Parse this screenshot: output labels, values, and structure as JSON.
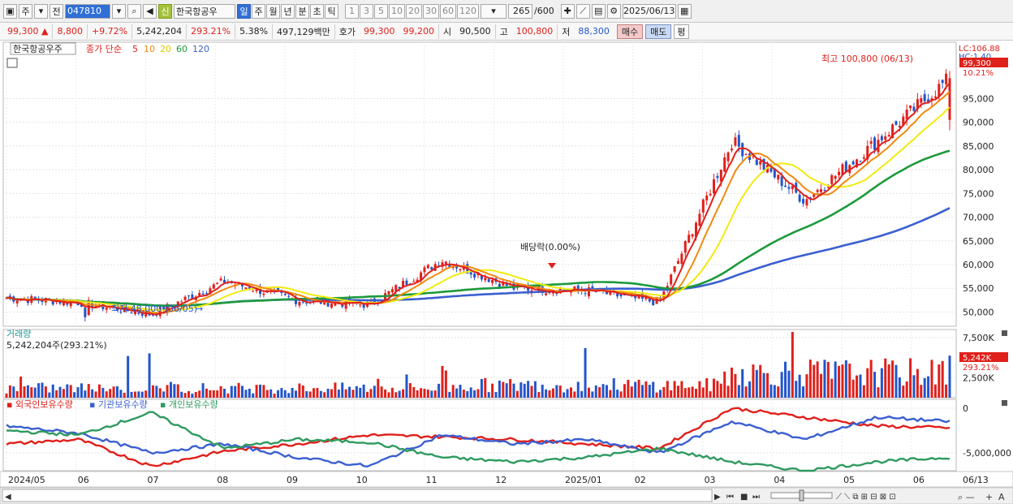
{
  "toolbar": {
    "market_select": "주",
    "scope_select": "전",
    "stock_code": "047810",
    "new_badge": "신",
    "stock_name": "한국항공우",
    "periods": [
      "일",
      "주",
      "월",
      "년",
      "분",
      "초",
      "틱"
    ],
    "selected_period": "일",
    "intervals": [
      "1",
      "3",
      "5",
      "10",
      "20",
      "30",
      "60",
      "120"
    ],
    "count": "265",
    "count_max": "/600",
    "date": "2025/06/13"
  },
  "quote": {
    "price": "99,300",
    "arrow": "▲",
    "change": "8,800",
    "change_pct": "+9.72%",
    "volume": "5,242,204",
    "volume_ratio": "293.21%",
    "turnover": "5.38%",
    "amount": "497,129백만",
    "hoga_label": "호가",
    "ask": "99,300",
    "bid": "99,200",
    "open_label": "시",
    "open": "90,500",
    "high_label": "고",
    "high": "100,800",
    "low_label": "저",
    "low": "88,300",
    "buy_label": "매수",
    "sell_label": "매도",
    "avg_label": "평"
  },
  "legend": {
    "name": "한국항공우주",
    "ma_label": "종가 단순",
    "periods": [
      "5",
      "10",
      "20",
      "60",
      "120"
    ]
  },
  "price_axis": {
    "lc_label": "LC:106.88",
    "hc_label": "HC:1.40",
    "last_price": "99,300",
    "last_pct": "10.21%",
    "ticks": [
      "95,000",
      "90,000",
      "85,000",
      "80,000",
      "75,000",
      "70,000",
      "65,000",
      "60,000",
      "55,000",
      "50,000"
    ]
  },
  "annotations": {
    "high": "최고 100,800 (06/13)",
    "low": "최저 48,000 (06/05)",
    "dividend": "배당락(0.00%)"
  },
  "volume_pane": {
    "title": "거래량",
    "value": "5,242,204주(293.21%)",
    "ticks": [
      "7,500K",
      "2,500K"
    ],
    "last_value": "5,242K",
    "last_pct": "293.21%"
  },
  "holdings_pane": {
    "series_labels": [
      "외국인보유수량",
      "기관보유수량",
      "개인보유수량"
    ],
    "ticks": [
      "0",
      "-5,000,000"
    ]
  },
  "x_axis": {
    "labels": [
      "2024/05",
      "06",
      "07",
      "08",
      "09",
      "10",
      "11",
      "12",
      "2025/01",
      "02",
      "03",
      "04",
      "05",
      "06"
    ],
    "right_label": "06/13"
  },
  "colors": {
    "up": "#e0201b",
    "down": "#2255cc",
    "ma5": "#e0201b",
    "ma10": "#f08a10",
    "ma20": "#f2ea10",
    "ma60": "#1d9a3c",
    "ma120": "#3a5fd0",
    "foreign": "#e0201b",
    "institution": "#3a5fd0",
    "individual": "#2e9a60"
  },
  "chart_data": {
    "type": "candlestick",
    "title": "한국항공우주",
    "x": [
      "2024/05",
      "06",
      "07",
      "08",
      "09",
      "10",
      "11",
      "12",
      "2025/01",
      "02",
      "03",
      "04",
      "05",
      "06/13"
    ],
    "price_close_anchors": [
      53000,
      52000,
      49500,
      56500,
      52500,
      51500,
      61000,
      55000,
      54500,
      52000,
      86000,
      73500,
      86000,
      99300
    ],
    "ylim": [
      47000,
      106880
    ],
    "high": {
      "value": 100800,
      "date": "06/13"
    },
    "low": {
      "value": 48000,
      "date": "06/05"
    },
    "last": {
      "close": 99300,
      "open": 90500,
      "high": 100800,
      "low": 88300,
      "volume": 5242204
    },
    "moving_averages": [
      "5",
      "10",
      "20",
      "60",
      "120"
    ],
    "volume_ylim": [
      0,
      8500000
    ],
    "holdings_ylim": [
      -7000000,
      1000000
    ],
    "holdings_series": [
      {
        "name": "외국인보유수량",
        "anchors": [
          -4000000,
          -3500000,
          -6500000,
          -4800000,
          -4000000,
          -3000000,
          -3200000,
          -3500000,
          -4000000,
          -4500000,
          0,
          -1000000,
          -2000000,
          -2200000
        ]
      },
      {
        "name": "기관보유수량",
        "anchors": [
          -2000000,
          -2800000,
          -5000000,
          -4000000,
          -5500000,
          -6500000,
          -3000000,
          -4000000,
          -3500000,
          -5000000,
          -1500000,
          -3500000,
          -1000000,
          -1500000
        ]
      },
      {
        "name": "개인보유수량",
        "anchors": [
          -2500000,
          -3000000,
          -500000,
          -4500000,
          -3500000,
          -3800000,
          -5500000,
          -6000000,
          -5500000,
          -4500000,
          -6000000,
          -7000000,
          -6000000,
          -5500000
        ]
      }
    ]
  }
}
